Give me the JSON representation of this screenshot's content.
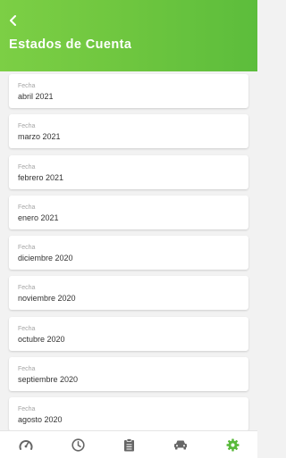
{
  "header": {
    "title": "Estados de Cuenta",
    "back_icon": "chevron-left-icon"
  },
  "statements": [
    {
      "label": "Fecha",
      "value": "abril 2021"
    },
    {
      "label": "Fecha",
      "value": "marzo 2021"
    },
    {
      "label": "Fecha",
      "value": "febrero 2021"
    },
    {
      "label": "Fecha",
      "value": "enero 2021"
    },
    {
      "label": "Fecha",
      "value": "diciembre 2020"
    },
    {
      "label": "Fecha",
      "value": "noviembre 2020"
    },
    {
      "label": "Fecha",
      "value": "octubre 2020"
    },
    {
      "label": "Fecha",
      "value": "septiembre 2020"
    },
    {
      "label": "Fecha",
      "value": "agosto 2020"
    }
  ],
  "tabbar": {
    "items": [
      {
        "icon": "gauge-icon",
        "active": false
      },
      {
        "icon": "clock-icon",
        "active": false
      },
      {
        "icon": "clipboard-icon",
        "active": false
      },
      {
        "icon": "car-icon",
        "active": false
      },
      {
        "icon": "gear-icon",
        "active": true
      }
    ]
  },
  "colors": {
    "header_start": "#7ccf45",
    "header_end": "#5cbd3c",
    "active_tab": "#58b93a",
    "inactive_tab": "#666666"
  }
}
